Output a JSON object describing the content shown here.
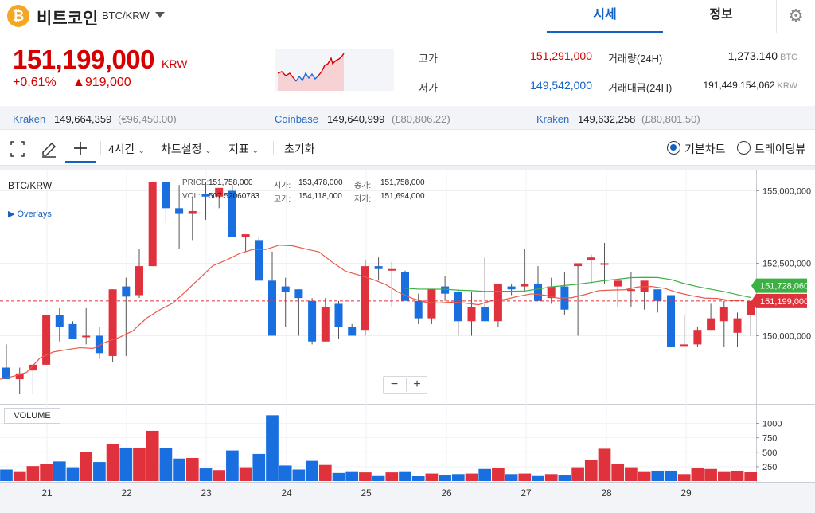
{
  "header": {
    "coin_symbol": "₿",
    "coin_name": "비트코인",
    "pair": "BTC/KRW",
    "tabs": [
      {
        "label": "시세",
        "active": true
      },
      {
        "label": "정보",
        "active": false
      }
    ],
    "settings_icon": "gear-icon"
  },
  "price": {
    "current": "151,199,000",
    "unit": "KRW",
    "change_pct": "+0.61%",
    "change_abs": "▲919,000",
    "color_up": "#d60000",
    "color_down": "#1261c4"
  },
  "stats": {
    "high_label": "고가",
    "high_value": "151,291,000",
    "low_label": "저가",
    "low_value": "149,542,000",
    "volume_label": "거래량(24H)",
    "volume_value": "1,273.140",
    "volume_unit": "BTC",
    "turnover_label": "거래대금(24H)",
    "turnover_value": "191,449,154,062",
    "turnover_unit": "KRW"
  },
  "exchanges": [
    {
      "name": "Kraken",
      "price": "149,664,359",
      "fx": "(€96,450.00)"
    },
    {
      "name": "Coinbase",
      "price": "149,640,999",
      "fx": "(£80,806.22)"
    },
    {
      "name": "Kraken",
      "price": "149,632,258",
      "fx": "(£80,801.50)"
    }
  ],
  "toolbar": {
    "fullscreen_icon": "fullscreen-icon",
    "pen_icon": "pen-icon",
    "crosshair_icon": "crosshair-icon",
    "interval": "4시간",
    "chart_settings": "차트설정",
    "indicators": "지표",
    "reset": "초기화",
    "view_basic": "기본차트",
    "view_trading": "트레이딩뷰"
  },
  "chart": {
    "symbol": "BTC/KRW",
    "overlays_label": "▶ Overlays",
    "ohlc": {
      "price_label": "PRICE:",
      "price_value": "151,758,000",
      "vol_label": "VOL:",
      "vol_value": "507.52060783",
      "open_label": "시가:",
      "open_value": "153,478,000",
      "high_label": "고가:",
      "high_value": "154,118,000",
      "close_label": "종가:",
      "close_value": "151,758,000",
      "low_label": "저가:",
      "low_value": "151,694,000"
    },
    "volume_label": "VOLUME",
    "zoom_out": "−",
    "zoom_in": "+"
  },
  "chart_data": {
    "type": "candlestick",
    "interval": "4시간",
    "x_ticks": [
      "21",
      "22",
      "23",
      "24",
      "25",
      "26",
      "27",
      "28",
      "29"
    ],
    "y_ticks": [
      "155,000,000",
      "152,500,000",
      "150,000,000"
    ],
    "y_ticks_values": [
      155000000,
      152500000,
      150000000
    ],
    "volume_ticks": [
      "1000",
      "750",
      "500",
      "250"
    ],
    "volume_ticks_values": [
      1000,
      750,
      500,
      250
    ],
    "current_price_tag": "151,199,000",
    "current_price_value": 151199000,
    "ma_tag": "151,728,060",
    "ma_value": 151728060,
    "colors": {
      "up": "#e0323c",
      "down": "#1a6fe0",
      "ma_red": "#e8594a",
      "ma_green": "#3cb043"
    },
    "candles": [
      {
        "o": 148900000,
        "h": 149700000,
        "l": 148550000,
        "c": 148500000,
        "v": 200
      },
      {
        "o": 148500000,
        "h": 148900000,
        "l": 148000000,
        "c": 148700000,
        "v": 170
      },
      {
        "o": 148800000,
        "h": 149000000,
        "l": 148000000,
        "c": 149000000,
        "v": 260
      },
      {
        "o": 149000000,
        "h": 150700000,
        "l": 149000000,
        "c": 150700000,
        "v": 290
      },
      {
        "o": 150700000,
        "h": 150950000,
        "l": 149800000,
        "c": 150300000,
        "v": 340
      },
      {
        "o": 150400000,
        "h": 150500000,
        "l": 149950000,
        "c": 149900000,
        "v": 240
      },
      {
        "o": 150000000,
        "h": 150950000,
        "l": 149700000,
        "c": 150000000,
        "v": 510
      },
      {
        "o": 150000000,
        "h": 150300000,
        "l": 149200000,
        "c": 149400000,
        "v": 330
      },
      {
        "o": 149300000,
        "h": 151600000,
        "l": 149100000,
        "c": 151600000,
        "v": 640
      },
      {
        "o": 151700000,
        "h": 152000000,
        "l": 149300000,
        "c": 151350000,
        "v": 580
      },
      {
        "o": 151400000,
        "h": 153000000,
        "l": 151300000,
        "c": 152400000,
        "v": 570
      },
      {
        "o": 152400000,
        "h": 155300000,
        "l": 152400000,
        "c": 155300000,
        "v": 870
      },
      {
        "o": 155300000,
        "h": 155300000,
        "l": 153900000,
        "c": 154400000,
        "v": 570
      },
      {
        "o": 154400000,
        "h": 155200000,
        "l": 153000000,
        "c": 154200000,
        "v": 390
      },
      {
        "o": 154200000,
        "h": 154800000,
        "l": 153300000,
        "c": 154300000,
        "v": 400
      },
      {
        "o": 154900000,
        "h": 155300000,
        "l": 154000000,
        "c": 154800000,
        "v": 220
      },
      {
        "o": 154800000,
        "h": 155000000,
        "l": 154400000,
        "c": 155100000,
        "v": 190
      },
      {
        "o": 155000000,
        "h": 155200000,
        "l": 153400000,
        "c": 153400000,
        "v": 530
      },
      {
        "o": 153400000,
        "h": 153400000,
        "l": 152900000,
        "c": 153500000,
        "v": 240
      },
      {
        "o": 153300000,
        "h": 153400000,
        "l": 151900000,
        "c": 151900000,
        "v": 470
      },
      {
        "o": 151900000,
        "h": 152900000,
        "l": 150200000,
        "c": 150000000,
        "v": 1140
      },
      {
        "o": 151700000,
        "h": 152000000,
        "l": 150300000,
        "c": 151500000,
        "v": 270
      },
      {
        "o": 151600000,
        "h": 151600000,
        "l": 150000000,
        "c": 151300000,
        "v": 200
      },
      {
        "o": 151200000,
        "h": 151300000,
        "l": 149700000,
        "c": 149800000,
        "v": 350
      },
      {
        "o": 149800000,
        "h": 151300000,
        "l": 149800000,
        "c": 151000000,
        "v": 280
      },
      {
        "o": 151100000,
        "h": 151200000,
        "l": 149900000,
        "c": 150300000,
        "v": 140
      },
      {
        "o": 150300000,
        "h": 150400000,
        "l": 150100000,
        "c": 150000000,
        "v": 170
      },
      {
        "o": 150200000,
        "h": 152600000,
        "l": 150000000,
        "c": 152400000,
        "v": 150
      },
      {
        "o": 152400000,
        "h": 152700000,
        "l": 151900000,
        "c": 152300000,
        "v": 100
      },
      {
        "o": 152250000,
        "h": 152550000,
        "l": 151000000,
        "c": 152300000,
        "v": 150
      },
      {
        "o": 152200000,
        "h": 152250000,
        "l": 151300000,
        "c": 151200000,
        "v": 170
      },
      {
        "o": 151200000,
        "h": 151450000,
        "l": 150400000,
        "c": 150600000,
        "v": 90
      },
      {
        "o": 150600000,
        "h": 151600000,
        "l": 150400000,
        "c": 151600000,
        "v": 130
      },
      {
        "o": 151700000,
        "h": 152050000,
        "l": 151200000,
        "c": 151450000,
        "v": 110
      },
      {
        "o": 151500000,
        "h": 151600000,
        "l": 150000000,
        "c": 150500000,
        "v": 120
      },
      {
        "o": 150500000,
        "h": 151500000,
        "l": 150000000,
        "c": 151000000,
        "v": 130
      },
      {
        "o": 151000000,
        "h": 152700000,
        "l": 150700000,
        "c": 150500000,
        "v": 210
      },
      {
        "o": 150500000,
        "h": 151800000,
        "l": 150300000,
        "c": 151800000,
        "v": 230
      },
      {
        "o": 151700000,
        "h": 151800000,
        "l": 151400000,
        "c": 151600000,
        "v": 120
      },
      {
        "o": 151700000,
        "h": 153000000,
        "l": 151500000,
        "c": 151800000,
        "v": 130
      },
      {
        "o": 151800000,
        "h": 152400000,
        "l": 151200000,
        "c": 151200000,
        "v": 100
      },
      {
        "o": 151300000,
        "h": 152000000,
        "l": 151100000,
        "c": 151700000,
        "v": 120
      },
      {
        "o": 151700000,
        "h": 152200000,
        "l": 150700000,
        "c": 150900000,
        "v": 110
      },
      {
        "o": 152400000,
        "h": 152500000,
        "l": 150000000,
        "c": 152500000,
        "v": 240
      },
      {
        "o": 152600000,
        "h": 152800000,
        "l": 151800000,
        "c": 152700000,
        "v": 370
      },
      {
        "o": 152500000,
        "h": 153200000,
        "l": 151800000,
        "c": 152500000,
        "v": 560
      },
      {
        "o": 151700000,
        "h": 151800000,
        "l": 151000000,
        "c": 151900000,
        "v": 300
      },
      {
        "o": 151600000,
        "h": 152200000,
        "l": 151000000,
        "c": 151600000,
        "v": 240
      },
      {
        "o": 151500000,
        "h": 151600000,
        "l": 150900000,
        "c": 151900000,
        "v": 170
      },
      {
        "o": 151600000,
        "h": 151600000,
        "l": 150800000,
        "c": 151200000,
        "v": 180
      },
      {
        "o": 151400000,
        "h": 151400000,
        "l": 149600000,
        "c": 149600000,
        "v": 180
      },
      {
        "o": 149700000,
        "h": 150700000,
        "l": 149600000,
        "c": 149700000,
        "v": 120
      },
      {
        "o": 149700000,
        "h": 150300000,
        "l": 149600000,
        "c": 150200000,
        "v": 230
      },
      {
        "o": 150200000,
        "h": 151100000,
        "l": 150200000,
        "c": 150600000,
        "v": 210
      },
      {
        "o": 150500000,
        "h": 151200000,
        "l": 149600000,
        "c": 151000000,
        "v": 170
      },
      {
        "o": 150100000,
        "h": 150800000,
        "l": 149600000,
        "c": 150600000,
        "v": 180
      },
      {
        "o": 150700000,
        "h": 151000000,
        "l": 150000000,
        "c": 151200000,
        "v": 160
      }
    ]
  }
}
